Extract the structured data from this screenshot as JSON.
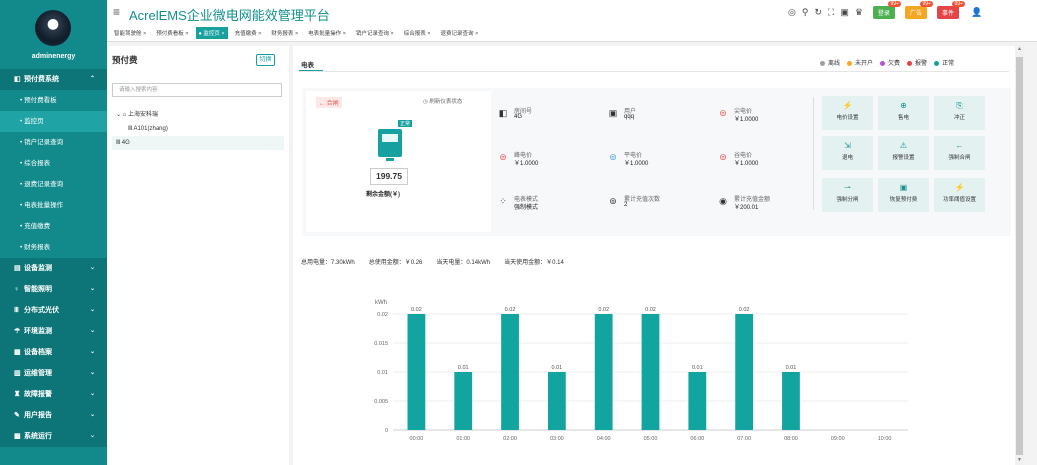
{
  "header": {
    "title": "AcrelEMS企业微电网能效管理平台",
    "badges": [
      {
        "label": "登录",
        "count": "99+",
        "color": "#4caf50"
      },
      {
        "label": "广告",
        "count": "99+",
        "color": "#f5a623"
      },
      {
        "label": "事件",
        "count": "99+",
        "color": "#e64545"
      }
    ]
  },
  "user": {
    "name": "adminenergy"
  },
  "sidebar": {
    "items": [
      {
        "label": "预付费系统",
        "type": "group",
        "icon": "prepay-icon"
      },
      {
        "label": "预付费看板",
        "type": "sub"
      },
      {
        "label": "监控页",
        "type": "sub",
        "active": true
      },
      {
        "label": "销户记录查询",
        "type": "sub"
      },
      {
        "label": "综合报表",
        "type": "sub"
      },
      {
        "label": "退费记录查询",
        "type": "sub"
      },
      {
        "label": "电表批量操作",
        "type": "sub"
      },
      {
        "label": "充值缴费",
        "type": "sub"
      },
      {
        "label": "财务报表",
        "type": "sub"
      },
      {
        "label": "设备监测",
        "type": "group",
        "icon": "monitor-icon"
      },
      {
        "label": "智能照明",
        "type": "group",
        "icon": "bulb-icon"
      },
      {
        "label": "分布式光伏",
        "type": "group",
        "icon": "solar-icon"
      },
      {
        "label": "环境监测",
        "type": "group",
        "icon": "env-icon"
      },
      {
        "label": "设备档案",
        "type": "group",
        "icon": "archive-icon"
      },
      {
        "label": "运维管理",
        "type": "group",
        "icon": "ops-icon"
      },
      {
        "label": "故障报警",
        "type": "group",
        "icon": "alarm-icon"
      },
      {
        "label": "用户报告",
        "type": "group",
        "icon": "report-icon"
      },
      {
        "label": "系统运行",
        "type": "group",
        "icon": "system-icon"
      }
    ]
  },
  "tabs": [
    {
      "label": "智能驾驶舱"
    },
    {
      "label": "预付费看板"
    },
    {
      "label": "● 监控页",
      "active": true
    },
    {
      "label": "充值缴费"
    },
    {
      "label": "财务报表"
    },
    {
      "label": "电表批量操作"
    },
    {
      "label": "销户记录查询"
    },
    {
      "label": "综合报表"
    },
    {
      "label": "退费记录查询"
    }
  ],
  "left_panel": {
    "title": "预付费",
    "switch_label": "切换",
    "search_placeholder": "请输入搜索内容",
    "tree": [
      {
        "label": "⌄ ⌂ 上海安科瑞",
        "level": 1
      },
      {
        "label": "Ⅲ A101(zhang)",
        "level": 2
      },
      {
        "label": "Ⅲ 4G",
        "level": 1,
        "selected": true
      }
    ]
  },
  "main": {
    "tab_label": "电表",
    "legend": [
      {
        "label": "离线",
        "color": "#9e9e9e"
      },
      {
        "label": "未开户",
        "color": "#f5a623"
      },
      {
        "label": "欠费",
        "color": "#b455d6"
      },
      {
        "label": "报警",
        "color": "#e64545"
      },
      {
        "label": "正常",
        "color": "#16a09e"
      }
    ],
    "meter": {
      "status_tag": "← 合闸",
      "refresh_label": "◷ 刷新仪表状态",
      "normal_tag": "正常",
      "balance": "199.75",
      "balance_label": "剩余金额(￥)"
    },
    "info": [
      {
        "label": "房间号",
        "value": "4G",
        "icon": "door-icon"
      },
      {
        "label": "用户",
        "value": "qqq",
        "icon": "user-icon"
      },
      {
        "label": "尖电价",
        "value": "￥1.0000",
        "icon": "price-icon"
      },
      {
        "label": "峰电价",
        "value": "￥1.0000",
        "icon": "price-icon"
      },
      {
        "label": "平电价",
        "value": "￥1.0000",
        "icon": "price-icon"
      },
      {
        "label": "谷电价",
        "value": "￥1.0000",
        "icon": "price-icon"
      },
      {
        "label": "电表模式",
        "value": "强制模式",
        "icon": "mode-icon"
      },
      {
        "label": "累计充值次数",
        "value": "2",
        "icon": "count-icon"
      },
      {
        "label": "累计充值金额",
        "value": "￥200.01",
        "icon": "money-icon"
      }
    ],
    "actions": [
      {
        "label": "电价设置",
        "icon": "⚡"
      },
      {
        "label": "售电",
        "icon": "⊕"
      },
      {
        "label": "冲正",
        "icon": "⎘"
      },
      {
        "label": "退电",
        "icon": "⇲"
      },
      {
        "label": "报警设置",
        "icon": "⚠"
      },
      {
        "label": "强制合闸",
        "icon": "←"
      },
      {
        "label": "强制分闸",
        "icon": "⇀"
      },
      {
        "label": "恢复预付费",
        "icon": "▣"
      },
      {
        "label": "功率阈值设置",
        "icon": "⚡"
      }
    ],
    "stats": [
      {
        "label": "总用电量：",
        "value": "7.30kWh"
      },
      {
        "label": "总使用金额：",
        "value": "￥0.26"
      },
      {
        "label": "当天电量：",
        "value": "0.14kWh"
      },
      {
        "label": "当天使用金额：",
        "value": "￥0.14"
      }
    ]
  },
  "chart_data": {
    "type": "bar",
    "ylabel": "kWh",
    "categories": [
      "00:00",
      "01:00",
      "02:00",
      "03:00",
      "04:00",
      "05:00",
      "06:00",
      "07:00",
      "08:00",
      "09:00",
      "10:00"
    ],
    "values": [
      0.02,
      0.01,
      0.02,
      0.01,
      0.02,
      0.02,
      0.01,
      0.02,
      0.01,
      null,
      null
    ],
    "ylim": [
      0,
      0.02
    ],
    "yticks": [
      "0",
      "0.005",
      "0.01",
      "0.015",
      "0.02"
    ],
    "bar_color": "#12a5a0",
    "grid": true
  }
}
